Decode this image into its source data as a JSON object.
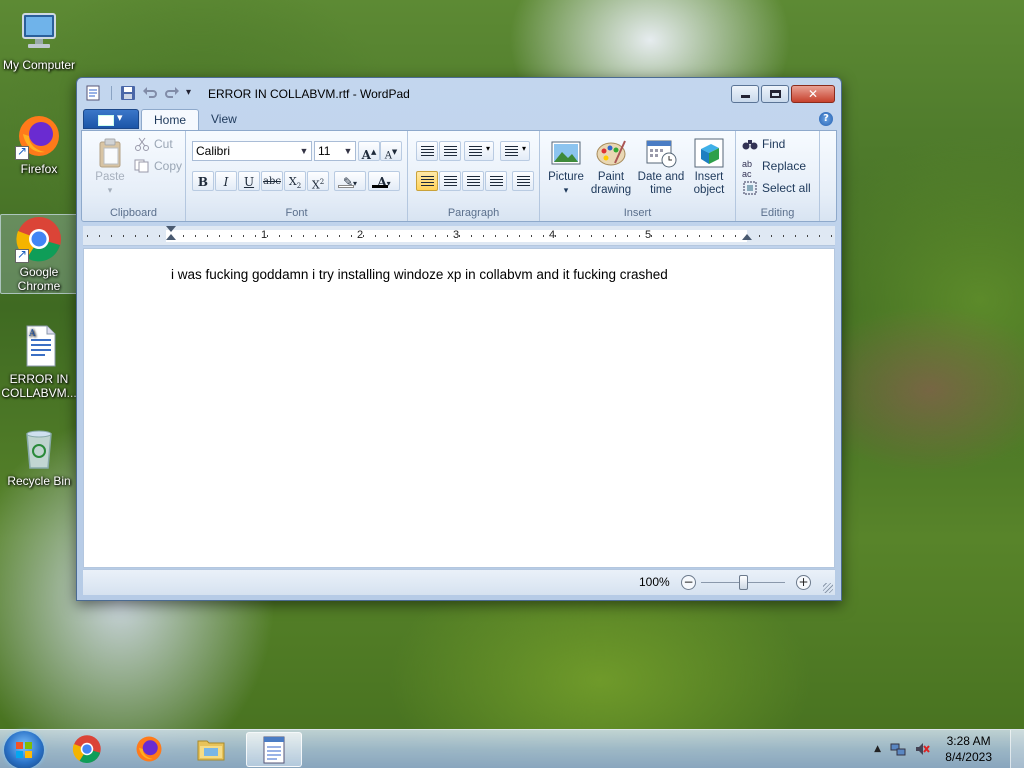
{
  "desktop": {
    "icons": [
      {
        "label": "My Computer",
        "icon": "computer-icon"
      },
      {
        "label": "Firefox",
        "icon": "firefox-icon"
      },
      {
        "label": "Google Chrome",
        "icon": "chrome-icon"
      },
      {
        "label": "ERROR IN COLLABVM...",
        "icon": "rtf-document-icon"
      },
      {
        "label": "Recycle Bin",
        "icon": "recycle-bin-icon"
      }
    ]
  },
  "window": {
    "title": "ERROR IN COLLABVM.rtf - WordPad",
    "tabs": [
      "Home",
      "View"
    ],
    "active_tab": "Home"
  },
  "ribbon": {
    "clipboard": {
      "label": "Clipboard",
      "paste": "Paste",
      "cut": "Cut",
      "copy": "Copy"
    },
    "font": {
      "label": "Font",
      "family": "Calibri",
      "size": "11"
    },
    "paragraph": {
      "label": "Paragraph"
    },
    "insert": {
      "label": "Insert",
      "picture": "Picture",
      "paint_line1": "Paint",
      "paint_line2": "drawing",
      "date_line1": "Date and",
      "date_line2": "time",
      "object_line1": "Insert",
      "object_line2": "object"
    },
    "editing": {
      "label": "Editing",
      "find": "Find",
      "replace": "Replace",
      "select_all": "Select all"
    }
  },
  "ruler": {
    "numbers": [
      "1",
      "2",
      "3",
      "4",
      "5"
    ]
  },
  "document": {
    "text": "i was fucking goddamn i try installing windoze xp in collabvm and it fucking crashed"
  },
  "statusbar": {
    "zoom": "100%",
    "zoom_level": 0.5
  },
  "taskbar": {
    "apps": [
      "chrome-icon",
      "firefox-icon",
      "file-explorer-icon",
      "wordpad-icon"
    ],
    "clock_time": "3:28 AM",
    "clock_date": "8/4/2023"
  },
  "colors": {
    "ribbon_active": "#ffd35a",
    "title_close": "#c7412c",
    "taskbar": "#a5bed7"
  }
}
